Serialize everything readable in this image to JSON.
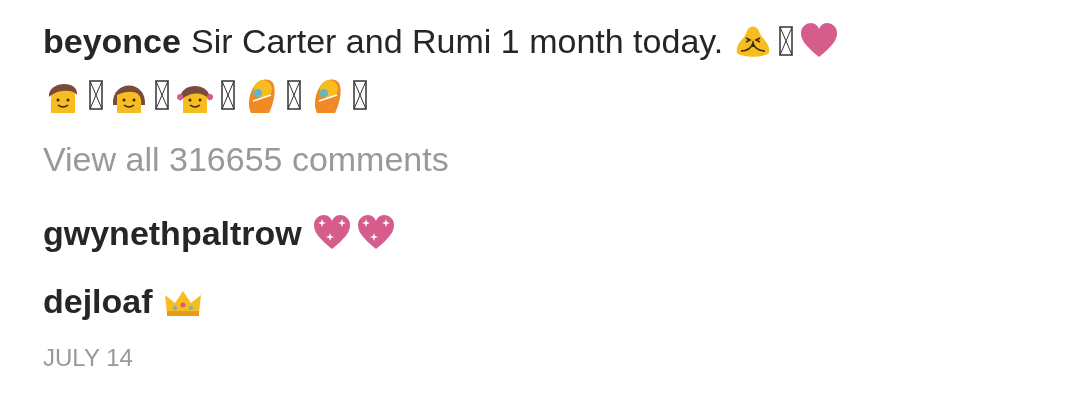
{
  "caption": {
    "username": "beyonce",
    "text": "Sir Carter and Rumi 1 month today."
  },
  "view_all": "View all 316655 comments",
  "comments": [
    {
      "username": "gwynethpaltrow"
    },
    {
      "username": "dejloaf"
    }
  ],
  "date": "JULY 14"
}
